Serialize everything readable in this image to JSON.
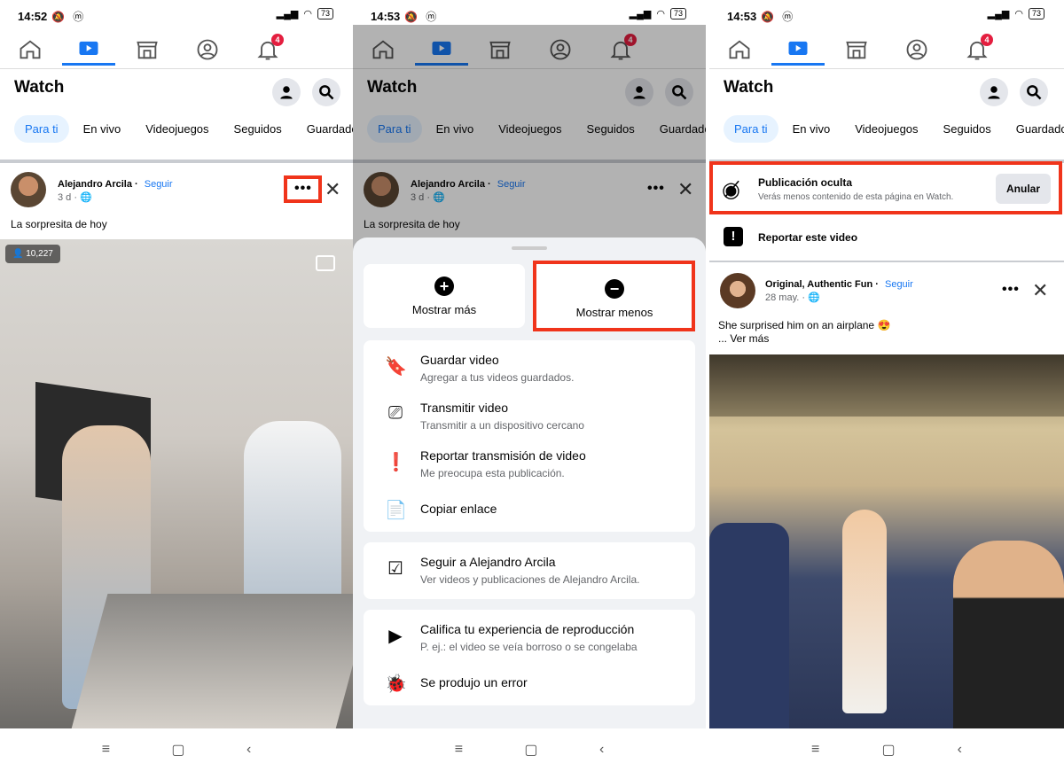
{
  "panels": [
    {
      "time": "14:52",
      "battery": "73",
      "notif": "4"
    },
    {
      "time": "14:53",
      "battery": "73",
      "notif": "4"
    },
    {
      "time": "14:53",
      "battery": "73",
      "notif": "4"
    }
  ],
  "watch_title": "Watch",
  "chips": [
    "Para ti",
    "En vivo",
    "Videojuegos",
    "Seguidos",
    "Guardado"
  ],
  "post1": {
    "author": "Alejandro Arcila",
    "follow": "Seguir",
    "meta": "3 d ·",
    "text": "La sorpresita de hoy",
    "views": "10,227"
  },
  "sheet": {
    "more": "Mostrar más",
    "less": "Mostrar menos",
    "group1": [
      {
        "title": "Guardar video",
        "sub": "Agregar a tus videos guardados.",
        "icon": "bookmark-icon"
      },
      {
        "title": "Transmitir video",
        "sub": "Transmitir a un dispositivo cercano",
        "icon": "cast-icon"
      },
      {
        "title": "Reportar transmisión de video",
        "sub": "Me preocupa esta publicación.",
        "icon": "report-icon"
      },
      {
        "title": "Copiar enlace",
        "sub": "",
        "icon": "copy-icon"
      }
    ],
    "group2": [
      {
        "title": "Seguir a Alejandro Arcila",
        "sub": "Ver videos y publicaciones de Alejandro Arcila.",
        "icon": "follow-icon"
      }
    ],
    "group3": [
      {
        "title": "Califica tu experiencia de reproducción",
        "sub": "P. ej.: el video se veía borroso o se congelaba",
        "icon": "play-icon"
      },
      {
        "title": "Se produjo un error",
        "sub": "",
        "icon": "bug-icon"
      }
    ]
  },
  "hidden": {
    "title": "Publicación oculta",
    "sub": "Verás menos contenido de esta página en Watch.",
    "undo": "Anular",
    "report": "Reportar este video"
  },
  "post2": {
    "author": "Original, Authentic Fun",
    "follow": "Seguir",
    "meta": "28 may. ·",
    "text": "She surprised him on an airplane 😍",
    "more": "... Ver más"
  },
  "colors": {
    "accent": "#1877f2",
    "highlight": "#f0341b"
  }
}
